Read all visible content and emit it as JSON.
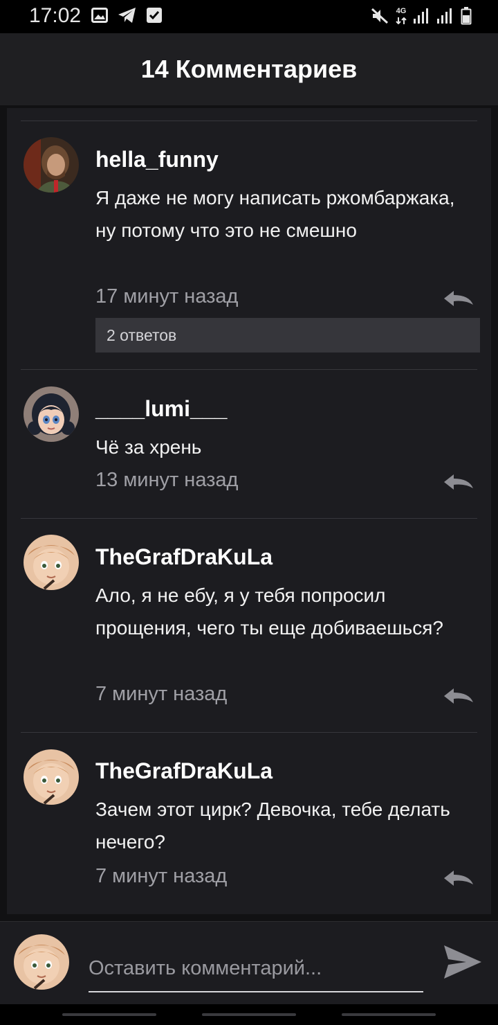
{
  "status_bar": {
    "time": "17:02",
    "network": "4G",
    "left_icons": [
      "image-icon",
      "telegram-icon",
      "checkbox-icon"
    ],
    "right_icons": [
      "mute-icon",
      "signal-icon",
      "signal-icon",
      "battery-icon"
    ]
  },
  "header": {
    "title": "14 Комментариев"
  },
  "comments": [
    {
      "username": "hella_funny",
      "text": "Я даже не могу написать ржомбаржака, ну потому что это не смешно",
      "time": "17 минут назад",
      "replies_label": "2 ответов"
    },
    {
      "username": "____lumi___",
      "text": "Чё за хрень",
      "time": "13 минут назад"
    },
    {
      "username": "TheGrafDraKuLa",
      "text": "Ало, я не ебу, я у тебя попросил прощения,  чего ты еще добиваешься?",
      "time": "7 минут назад"
    },
    {
      "username": "TheGrafDraKuLa",
      "text": "Зачем этот цирк? Девочка, тебе делать нечего?",
      "time": "7 минут назад"
    }
  ],
  "input": {
    "placeholder": "Оставить комментарий..."
  },
  "colors": {
    "background": "#111113",
    "panel": "#1c1c20",
    "header": "#1f1f22",
    "replies_button": "#36363b",
    "timestamp": "#a0a0a6"
  }
}
